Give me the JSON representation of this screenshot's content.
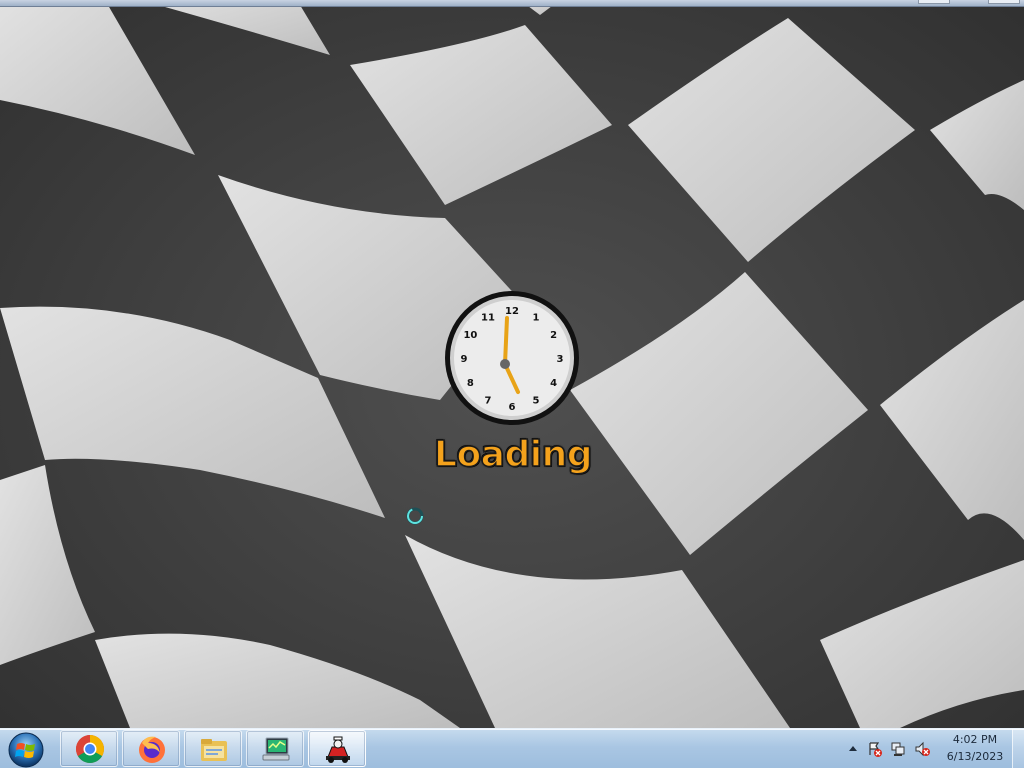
{
  "loading": {
    "text": "Loading",
    "clock_numerals": [
      "12",
      "1",
      "2",
      "3",
      "4",
      "5",
      "6",
      "7",
      "8",
      "9",
      "10",
      "11"
    ]
  },
  "taskbar": {
    "start_icon": "windows-logo-icon",
    "pinned": [
      {
        "name": "chrome",
        "icon": "chrome-icon"
      },
      {
        "name": "firefox",
        "icon": "firefox-icon"
      },
      {
        "name": "explorer",
        "icon": "folder-icon"
      },
      {
        "name": "system",
        "icon": "computer-icon"
      },
      {
        "name": "racing-game",
        "icon": "race-car-icon",
        "active": true
      }
    ],
    "tray": {
      "time": "4:02 PM",
      "date": "6/13/2023"
    }
  },
  "colors": {
    "loading_orange": "#f4a21c",
    "clock_hands": "#e8a317",
    "taskbar": "#a9c6e3"
  }
}
